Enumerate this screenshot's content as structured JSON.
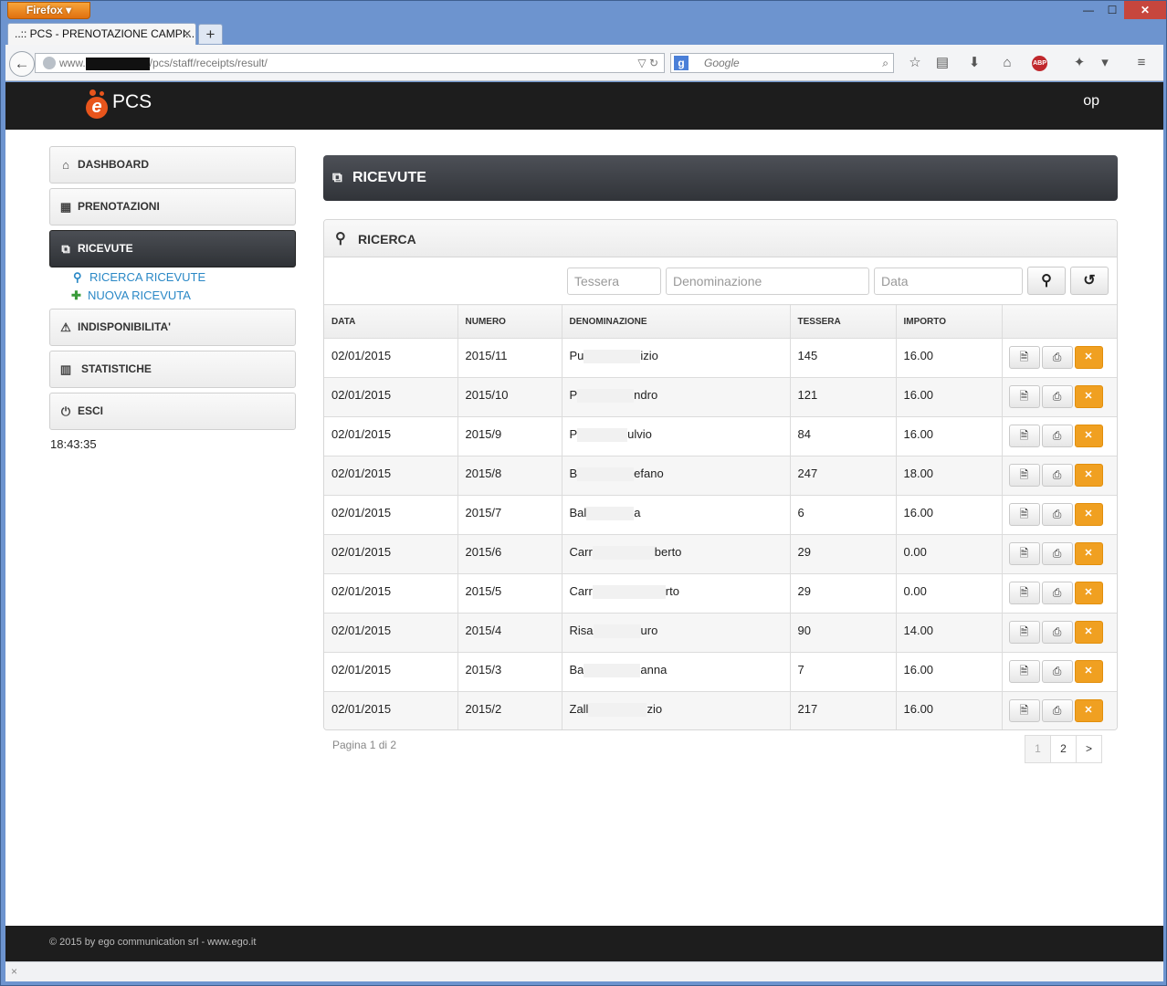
{
  "browser": {
    "app_button": "Firefox ▾",
    "tab_title": "..:: PCS - PRENOTAZIONE CAMPI...",
    "url_prefix": "www.",
    "url_suffix": "/pcs/staff/receipts/result/",
    "search_placeholder": "Google",
    "window_controls": {
      "minimize": "—",
      "maximize": "☐",
      "close": "✕"
    }
  },
  "app": {
    "brand": "PCS",
    "user": "op"
  },
  "sidebar": {
    "items": [
      {
        "label": "DASHBOARD",
        "icon": "home-icon"
      },
      {
        "label": "PRENOTAZIONI",
        "icon": "calendar-icon"
      },
      {
        "label": "RICEVUTE",
        "icon": "receipts-icon",
        "active": true
      },
      {
        "label": "INDISPONIBILITA'",
        "icon": "warning-icon"
      },
      {
        "label": "STATISTICHE",
        "icon": "stats-icon"
      },
      {
        "label": "ESCI",
        "icon": "power-icon"
      }
    ],
    "subitems": [
      {
        "label": "RICERCA RICEVUTE",
        "icon": "search-icon"
      },
      {
        "label": "NUOVA RICEVUTA",
        "icon": "plus-icon"
      }
    ],
    "clock": "18:43:35"
  },
  "main": {
    "title": "RICEVUTE",
    "search_panel_title": "RICERCA",
    "filters": {
      "tessera_placeholder": "Tessera",
      "denominazione_placeholder": "Denominazione",
      "data_placeholder": "Data"
    },
    "columns": [
      "DATA",
      "NUMERO",
      "DENOMINAZIONE",
      "TESSERA",
      "IMPORTO",
      ""
    ],
    "rows": [
      {
        "data": "02/01/2015",
        "numero": "2015/11",
        "den_a": "Pu",
        "den_b": "izio",
        "tessera": "145",
        "importo": "16.00"
      },
      {
        "data": "02/01/2015",
        "numero": "2015/10",
        "den_a": "P",
        "den_b": "ndro",
        "tessera": "121",
        "importo": "16.00"
      },
      {
        "data": "02/01/2015",
        "numero": "2015/9",
        "den_a": "P",
        "den_b": "ulvio",
        "tessera": "84",
        "importo": "16.00"
      },
      {
        "data": "02/01/2015",
        "numero": "2015/8",
        "den_a": "B",
        "den_b": "efano",
        "tessera": "247",
        "importo": "18.00"
      },
      {
        "data": "02/01/2015",
        "numero": "2015/7",
        "den_a": "Bal",
        "den_b": "a",
        "tessera": "6",
        "importo": "16.00"
      },
      {
        "data": "02/01/2015",
        "numero": "2015/6",
        "den_a": "Carr",
        "den_b": "berto",
        "tessera": "29",
        "importo": "0.00"
      },
      {
        "data": "02/01/2015",
        "numero": "2015/5",
        "den_a": "Carr",
        "den_b": "rto",
        "tessera": "29",
        "importo": "0.00"
      },
      {
        "data": "02/01/2015",
        "numero": "2015/4",
        "den_a": "Risa",
        "den_b": "uro",
        "tessera": "90",
        "importo": "14.00"
      },
      {
        "data": "02/01/2015",
        "numero": "2015/3",
        "den_a": "Ba",
        "den_b": "anna",
        "tessera": "7",
        "importo": "16.00"
      },
      {
        "data": "02/01/2015",
        "numero": "2015/2",
        "den_a": "Zall",
        "den_b": "zio",
        "tessera": "217",
        "importo": "16.00"
      }
    ],
    "pagination": {
      "info": "Pagina 1 di 2",
      "pages": [
        "1",
        "2",
        ">"
      ]
    }
  },
  "footer": {
    "text": "© 2015 by ego communication srl - www.ego.it"
  },
  "statusbar": {
    "close_glyph": "×"
  },
  "colors": {
    "accent": "#2a88c6",
    "delete": "#f0a021",
    "topbar": "#1d1d1d",
    "logo": "#e8551c"
  }
}
